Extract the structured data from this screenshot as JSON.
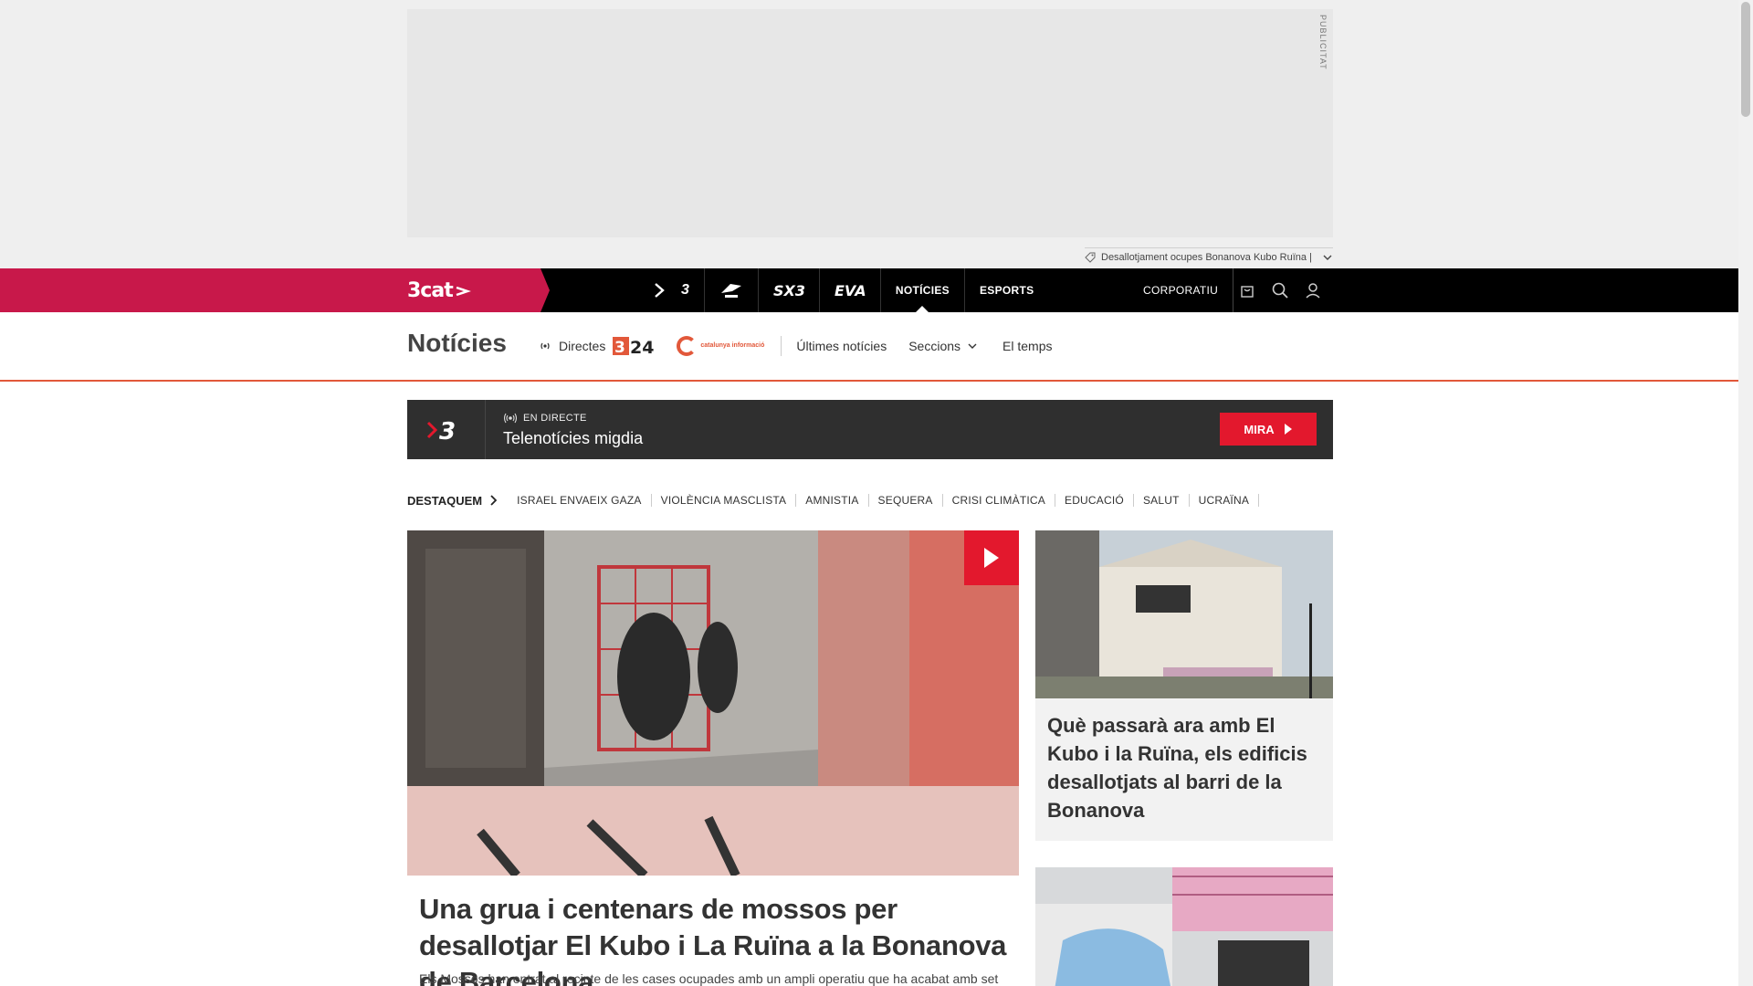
{
  "ad": {
    "label": "PUBLICITAT",
    "tag_text": "Desallotjament ocupes Bonanova Kubo Ruïna |"
  },
  "topnav": {
    "brand": "3cat",
    "channels": [
      "3",
      "CatRàdio",
      "SX3",
      "EVA"
    ],
    "links": [
      "NOTÍCIES",
      "ESPORTS"
    ],
    "active": "NOTÍCIES",
    "corporate": "CORPORATIU",
    "icons": [
      "shop-bag-icon",
      "search-icon",
      "user-icon"
    ]
  },
  "section": {
    "title": "Notícies",
    "directes": "Directes",
    "logo_324": "3/24",
    "logo_catinfo": "catalunya informació",
    "links": [
      "Últimes notícies",
      "Seccions",
      "El temps"
    ]
  },
  "live": {
    "channel": "3",
    "status": "EN DIRECTE",
    "title": "Telenotícies migdia",
    "button": "MIRA"
  },
  "destaquem": {
    "label": "DESTAQUEM",
    "tags": [
      "ISRAEL ENVAEIX GAZA",
      "VIOLÈNCIA MASCLISTA",
      "AMNISTIA",
      "SEQUERA",
      "CRISI CLIMÀTICA",
      "EDUCACIÓ",
      "SALUT",
      "UCRAÏNA"
    ]
  },
  "main_article": {
    "title": "Una grua i centenars de mossos per desallotjar El Kubo i La Ruïna a la Bonanova de Barcelona",
    "summary": "Els Mossos han entrat al recinte de les cases ocupades amb un ampli operatiu que ha acabat amb set"
  },
  "side_articles": [
    {
      "title": "Què passarà ara amb El Kubo i la Ruïna, els edificis desallotjats al barri de la Bonanova"
    }
  ],
  "colors": {
    "brand_red": "#c8184a",
    "accent_orange": "#e2583a",
    "live_red": "#e3182d",
    "live_bg": "#2f2f2f"
  }
}
